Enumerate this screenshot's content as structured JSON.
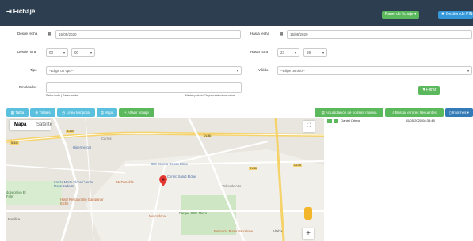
{
  "topbar": {
    "title": "Fichaje",
    "panel_label": "Panel de fichaje ▾",
    "pin_label": "Gestión de PIN"
  },
  "filters": {
    "desde_fecha_label": "Desde fecha",
    "desde_fecha_value": "15/05/2020",
    "hasta_fecha_label": "Hasta fecha",
    "hasta_fecha_value": "15/05/2020",
    "desde_hora_label": "Desde hora",
    "desde_hora_h": "00",
    "desde_hora_m": "00",
    "hasta_hora_label": "Hasta hora",
    "hasta_hora_h": "23",
    "hasta_hora_m": "59",
    "tipo_label": "Tipo",
    "tipo_value": "--Elige un tipo--",
    "valido_label": "Válido",
    "valido_value": "--Elige un tipo--",
    "empleados_label": "Empleados",
    "select_links": "Selec.todo | Selec.nada",
    "hint": "Mantén pulsado Ctrl para seleccionar varios",
    "filter_label": "Filtrar"
  },
  "toolbar": {
    "tabla": "Tabla",
    "totales": "Totales",
    "linea": "Línea temporal",
    "mapa": "Mapa",
    "anadir": "Añadir fichaje",
    "actualizar": "Actualización de nombre masiva",
    "buscar": "Buscar errores frecuentes",
    "informes": "Informes ▾"
  },
  "map": {
    "type_map": "Mapa",
    "type_sat": "Satélite",
    "labels": [
      "Hipermercat",
      "IES Severo Ochoa Elche",
      "Centro Salud Elche",
      "McDonald's",
      "Lanza Morte Elche / Venta Motorizada Sl",
      "Hotel Restaurante Campanar Elche",
      "Parque 3 De Mayo",
      "Farmacia Plaza Barcelona",
      "Mercadona",
      "Carrús",
      "Valverde Alto",
      "ddeportivo El Faler",
      "Masilica",
      "Altabix"
    ],
    "roads": [
      "N-340",
      "CV-86",
      "CV-86",
      "CV-86",
      "N-340"
    ]
  },
  "results": {
    "name": "Daniel Ortega",
    "datetime": "15/05/2020 08:33:48"
  }
}
